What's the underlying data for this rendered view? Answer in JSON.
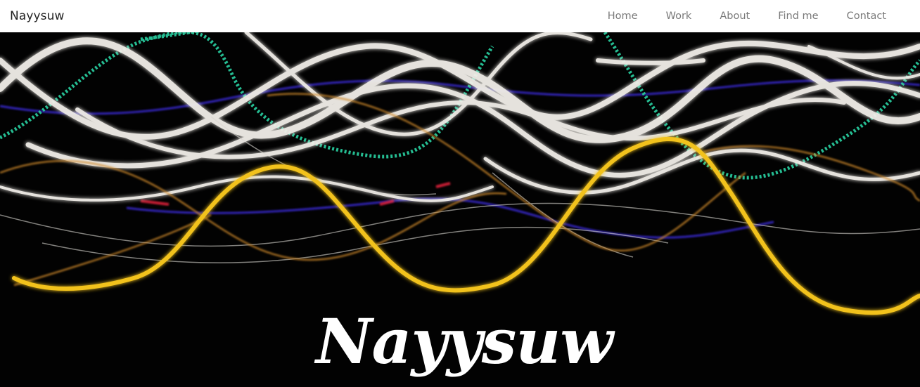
{
  "navbar": {
    "brand": "Nayysuw",
    "links": [
      {
        "label": "Home"
      },
      {
        "label": "Work"
      },
      {
        "label": "About"
      },
      {
        "label": "Find me"
      },
      {
        "label": "Contact"
      }
    ]
  },
  "hero": {
    "title": "Nayysuw",
    "image": "long-exposure light trails on black background",
    "colors": {
      "background": "#020202",
      "white_trails": "#f2efe9",
      "gold_trail": "#f2c21b",
      "teal_trail": "#27c79a",
      "blue_trail": "#3a2bd8",
      "red_trail": "#e0203a"
    }
  }
}
